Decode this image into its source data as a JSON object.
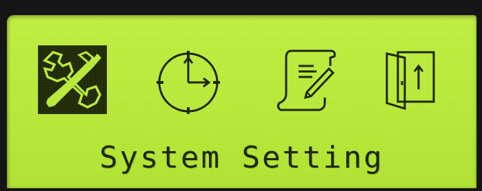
{
  "screen": {
    "menu_icons": [
      {
        "icon": "tools-icon",
        "selected": true
      },
      {
        "icon": "clock-icon",
        "selected": false
      },
      {
        "icon": "document-icon",
        "selected": false
      },
      {
        "icon": "exit-door-icon",
        "selected": false
      }
    ],
    "selected_caption": "System Setting",
    "colors": {
      "lcd_background": "#bdee3f",
      "pixel_dark": "#1c2408",
      "bezel": "#151515"
    }
  }
}
